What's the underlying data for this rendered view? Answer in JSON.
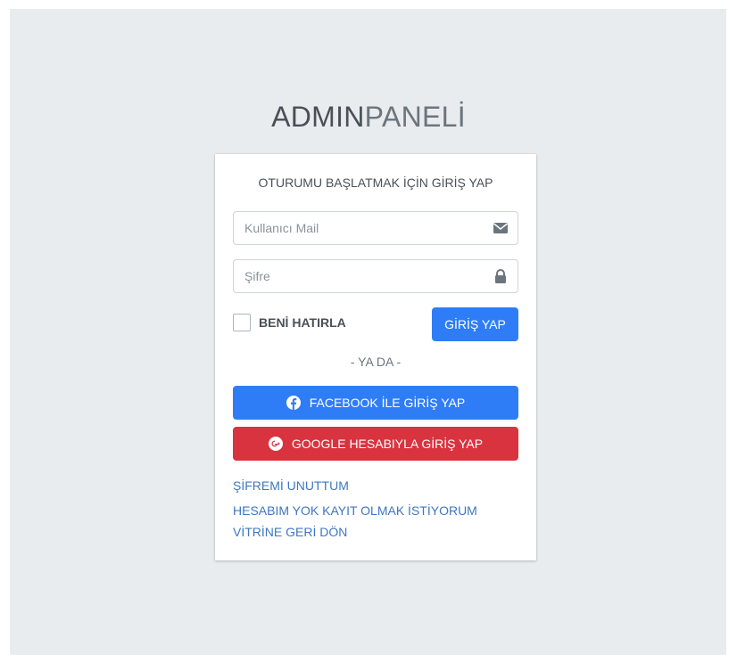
{
  "logo": {
    "bold": "ADMIN",
    "light": "PANELİ"
  },
  "login": {
    "message": "OTURUMU BAŞLATMAK İÇİN GİRİŞ YAP",
    "email_placeholder": "Kullanıcı Mail",
    "email_value": "",
    "password_placeholder": "Şifre",
    "password_value": "",
    "remember_label": "BENİ HATIRLA",
    "submit_label": "GİRİŞ YAP",
    "or_text": "- YA DA -",
    "facebook_label": "FACEBOOK İLE GİRİŞ YAP",
    "google_label": "GOOGLE HESABIYLA GİRİŞ YAP"
  },
  "links": {
    "forgot": "ŞİFREMİ UNUTTUM",
    "register": "HESABIM YOK KAYIT OLMAK İSTİYORUM",
    "back": "VİTRİNE GERİ DÖN"
  },
  "icons": {
    "email": "envelope-icon",
    "password": "lock-icon",
    "facebook": "facebook-icon",
    "google": "google-plus-icon"
  },
  "colors": {
    "primary": "#2f7df6",
    "danger": "#d9333f",
    "link": "#3d77c2",
    "background": "#e9ecef"
  }
}
